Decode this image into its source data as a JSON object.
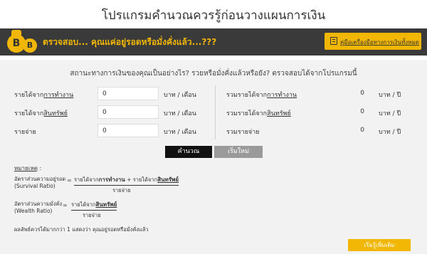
{
  "page": {
    "title": "โปรแกรมคำนวณควรรู้ก่อนวางแผนการเงิน"
  },
  "banner": {
    "coin_big": "B",
    "coin_small": "B",
    "headline": "ตรวจสอบ... คุณแค่อยู่รอดหรือมั่งคั่งแล้ว...???",
    "guide_button": "คู่มือเครื่องมือทางการเงินทั้งหมด",
    "accent_color": "#f2b705",
    "bar_color": "#3a3a3a"
  },
  "form": {
    "question": "สถานะทางการเงินของคุณเป็นอย่างไร? รวยหรือมั่งคั่งแล้วหรือยัง? ตรวจสอบได้จากโปรแกรมนี้",
    "rows": [
      {
        "label_prefix": "รายได้จาก",
        "label_emph": "การทำงาน",
        "value": "0",
        "unit": "บาท / เดือน"
      },
      {
        "label_prefix": "รายได้จาก",
        "label_emph": "สินทรัพย์",
        "value": "0",
        "unit": "บาท / เดือน"
      },
      {
        "label_prefix": "รายจ่าย",
        "label_emph": "",
        "value": "0",
        "unit": "บาท / เดือน"
      }
    ],
    "totals": [
      {
        "label_prefix": "รวมรายได้จาก",
        "label_emph": "การทำงาน",
        "value": "0",
        "unit": "บาท / ปี"
      },
      {
        "label_prefix": "รวมรายได้จาก",
        "label_emph": "สินทรัพย์",
        "value": "0",
        "unit": "บาท / ปี"
      },
      {
        "label_prefix": "รวมรายจ่าย",
        "label_emph": "",
        "value": "0",
        "unit": "บาท / ปี"
      }
    ],
    "calc_button": "คำนวณ",
    "reset_button": "เริ่มใหม่"
  },
  "notes": {
    "heading": "หมายเหตุ",
    "heading_suffix": " :",
    "survival": {
      "label": "อัตราส่วนความอยู่รอด",
      "label_en": "(Survival Ratio)",
      "eq": "=",
      "num_a": "รายได้จาก",
      "num_a_emph": "การทำงาน",
      "num_plus": " + รายได้จาก",
      "num_b_emph": "สินทรัพย์",
      "den": "รายจ่าย"
    },
    "wealth": {
      "label": "อัตราส่วนความมั่งคั่ง",
      "label_en": "(Wealth Ratio)",
      "eq": "=",
      "num_a": "รายได้จาก",
      "num_b_emph": "สินทรัพย์",
      "den": "รายจ่าย"
    },
    "conclusion": "ผลลัพธ์ควรได้มากกว่า 1 แสดงว่า คุณอยู่รอดหรือมั่งคั่งแล้ว"
  },
  "footer": {
    "invest_button": "เริ่มรู้เพิ่มเติม"
  }
}
